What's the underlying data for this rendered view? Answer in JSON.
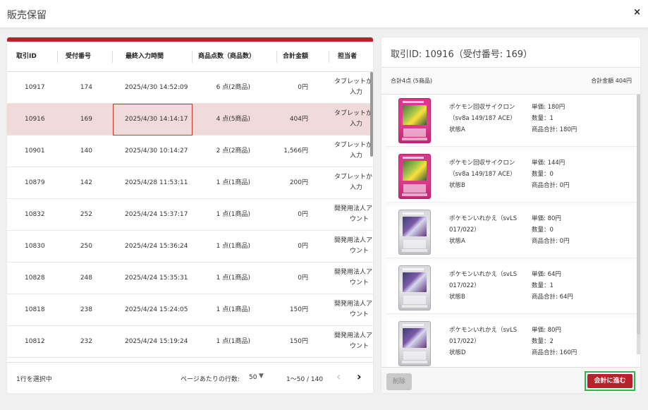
{
  "header": {
    "title": "販売保留",
    "close": "×"
  },
  "table": {
    "columns": [
      "取引ID",
      "受付番号",
      "最終入力時間",
      "商品点数（商品数）",
      "合計金額",
      "担当者"
    ],
    "rows": [
      {
        "id": "10917",
        "receipt": "174",
        "time": "2025/4/30 14:52:09",
        "count": "6 点(2商品)",
        "total": "0円",
        "staff1": "タブレットか",
        "staff2": "入力"
      },
      {
        "id": "10916",
        "receipt": "169",
        "time": "2025/4/30 14:14:17",
        "count": "4 点(5商品)",
        "total": "404円",
        "staff1": "タブレットか",
        "staff2": "入力"
      },
      {
        "id": "10901",
        "receipt": "140",
        "time": "2025/4/30 10:14:27",
        "count": "2 点(2商品)",
        "total": "1,566円",
        "staff1": "タブレットか",
        "staff2": "入力"
      },
      {
        "id": "10879",
        "receipt": "142",
        "time": "2025/4/28 11:53:11",
        "count": "1 点(1商品)",
        "total": "200円",
        "staff1": "タブレットか",
        "staff2": "入力"
      },
      {
        "id": "10832",
        "receipt": "252",
        "time": "2025/4/24 15:37:17",
        "count": "1 点(1商品)",
        "total": "0円",
        "staff1": "開発用法人ア",
        "staff2": "ウント"
      },
      {
        "id": "10830",
        "receipt": "250",
        "time": "2025/4/24 15:36:24",
        "count": "1 点(1商品)",
        "total": "0円",
        "staff1": "開発用法人ア",
        "staff2": "ウント"
      },
      {
        "id": "10828",
        "receipt": "248",
        "time": "2025/4/24 15:35:31",
        "count": "1 点(1商品)",
        "total": "0円",
        "staff1": "開発用法人ア",
        "staff2": "ウント"
      },
      {
        "id": "10818",
        "receipt": "238",
        "time": "2025/4/24 15:24:05",
        "count": "1 点(1商品)",
        "total": "150円",
        "staff1": "開発用法人ア",
        "staff2": "ウント"
      },
      {
        "id": "10812",
        "receipt": "232",
        "time": "2025/4/24 15:19:24",
        "count": "1 点(1商品)",
        "total": "150円",
        "staff1": "開発用法人ア",
        "staff2": "ウント"
      }
    ],
    "selected_index": 1
  },
  "footer": {
    "selected_text": "1行を選択中",
    "rows_per_page_label": "ページあたりの行数:",
    "rows_per_page_value": "50",
    "range": "1〜50 / 140",
    "prev": "‹",
    "next": "›"
  },
  "detail": {
    "title": "取引ID: 10916（受付番号: 169）",
    "summary_left": "合計4点 (5商品)",
    "summary_right": "合計金額 404円",
    "items": [
      {
        "card": "pink",
        "name1": "ポケモン回収サイクロン",
        "name2": "（sv8a 149/187 ACE）",
        "cond": "状態A",
        "unit": "単価: 180円",
        "qty": "数量：1",
        "subtotal": "商品合計: 180円"
      },
      {
        "card": "pink",
        "name1": "ポケモン回収サイクロン",
        "name2": "（sv8a 149/187 ACE）",
        "cond": "状態B",
        "unit": "単価: 144円",
        "qty": "数量：0",
        "subtotal": "商品合計: 0円"
      },
      {
        "card": "silver",
        "name1": "ポケモンいれかえ（svLS",
        "name2": "017/022）",
        "cond": "状態A",
        "unit": "単価: 80円",
        "qty": "数量：0",
        "subtotal": "商品合計: 0円"
      },
      {
        "card": "silver",
        "name1": "ポケモンいれかえ（svLS",
        "name2": "017/022）",
        "cond": "状態B",
        "unit": "単価: 64円",
        "qty": "数量：1",
        "subtotal": "商品合計: 64円"
      },
      {
        "card": "silver",
        "name1": "ポケモンいれかえ（svLS",
        "name2": "017/022）",
        "cond": "状態D",
        "unit": "単価: 80円",
        "qty": "数量：2",
        "subtotal": "商品合計: 160円"
      }
    ],
    "delete_label": "削除",
    "checkout_label": "会計に進む"
  },
  "colors": {
    "accent": "#b8232b",
    "selected_row": "#f1dada",
    "focus_outline": "#2eb84c"
  }
}
